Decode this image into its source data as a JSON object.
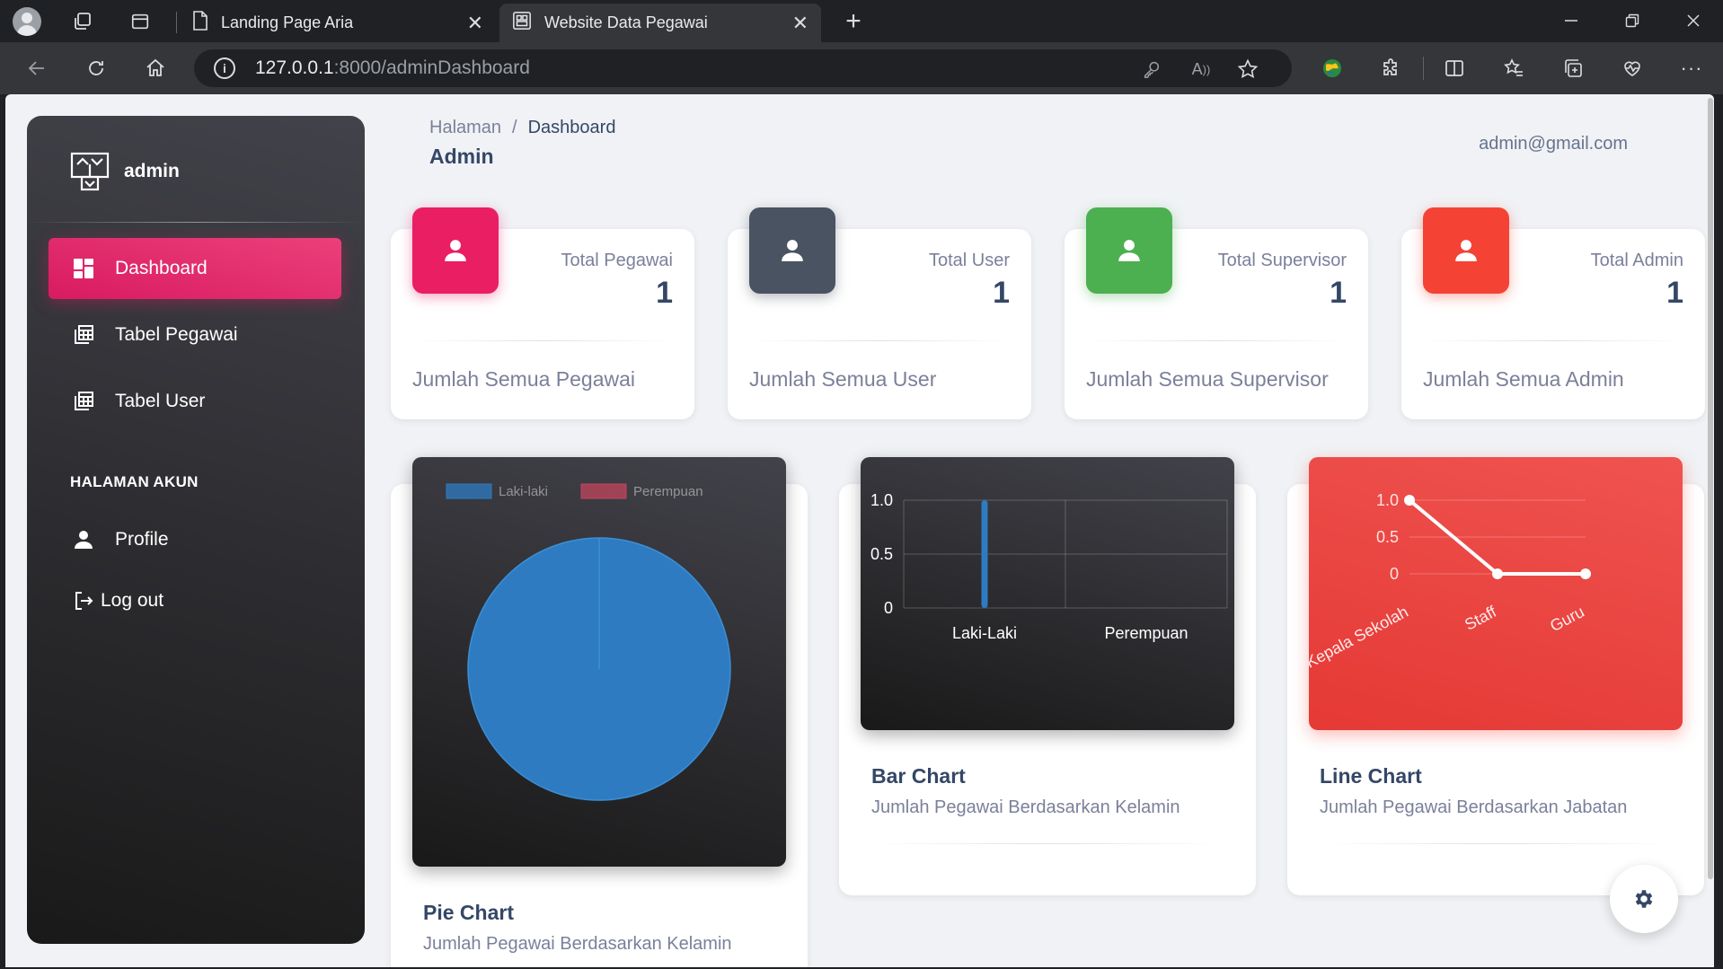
{
  "browser": {
    "tabs": [
      {
        "title": "Landing Page Aria"
      },
      {
        "title": "Website Data Pegawai"
      }
    ],
    "url_host": "127.0.0.1",
    "url_rest": ":8000/adminDashboard"
  },
  "sidebar": {
    "brand": "admin",
    "items": [
      {
        "label": "Dashboard"
      },
      {
        "label": "Tabel Pegawai"
      },
      {
        "label": "Tabel User"
      }
    ],
    "section_title": "HALAMAN AKUN",
    "account_items": [
      {
        "label": "Profile"
      },
      {
        "label": "Log out"
      }
    ]
  },
  "header": {
    "breadcrumb_parent": "Halaman",
    "breadcrumb_separator": "/",
    "breadcrumb_current": "Dashboard",
    "title": "Admin",
    "email": "admin@gmail.com"
  },
  "stats": [
    {
      "label": "Total Pegawai",
      "value": "1",
      "desc": "Jumlah Semua Pegawai",
      "color": "#e91e63"
    },
    {
      "label": "Total User",
      "value": "1",
      "desc": "Jumlah Semua User",
      "color": "#495361"
    },
    {
      "label": "Total Supervisor",
      "value": "1",
      "desc": "Jumlah Semua Supervisor",
      "color": "#4caf50"
    },
    {
      "label": "Total Admin",
      "value": "1",
      "desc": "Jumlah Semua Admin",
      "color": "#f44335"
    }
  ],
  "charts": [
    {
      "title": "Pie Chart",
      "subtitle": "Jumlah Pegawai Berdasarkan Kelamin"
    },
    {
      "title": "Bar Chart",
      "subtitle": "Jumlah Pegawai Berdasarkan Kelamin"
    },
    {
      "title": "Line Chart",
      "subtitle": "Jumlah Pegawai Berdasarkan Jabatan"
    }
  ],
  "chart_data": [
    {
      "type": "pie",
      "categories": [
        "Laki-laki",
        "Perempuan"
      ],
      "values": [
        1,
        0
      ],
      "colors": [
        "#2e7bc2",
        "#c2455e"
      ],
      "legend": "top"
    },
    {
      "type": "bar",
      "categories": [
        "Laki-Laki",
        "Perempuan"
      ],
      "values": [
        1,
        0
      ],
      "ylim": [
        0,
        1
      ],
      "yticks": [
        "0",
        "0.5",
        "1.0"
      ],
      "color": "#2e7bc2",
      "grid": true
    },
    {
      "type": "line",
      "categories": [
        "Kepala Sekolah",
        "Staff",
        "Guru"
      ],
      "values": [
        1,
        0,
        0
      ],
      "ylim": [
        0,
        1
      ],
      "yticks": [
        "0",
        "0.5",
        "1.0"
      ],
      "color": "#ffffff",
      "grid": true
    }
  ]
}
